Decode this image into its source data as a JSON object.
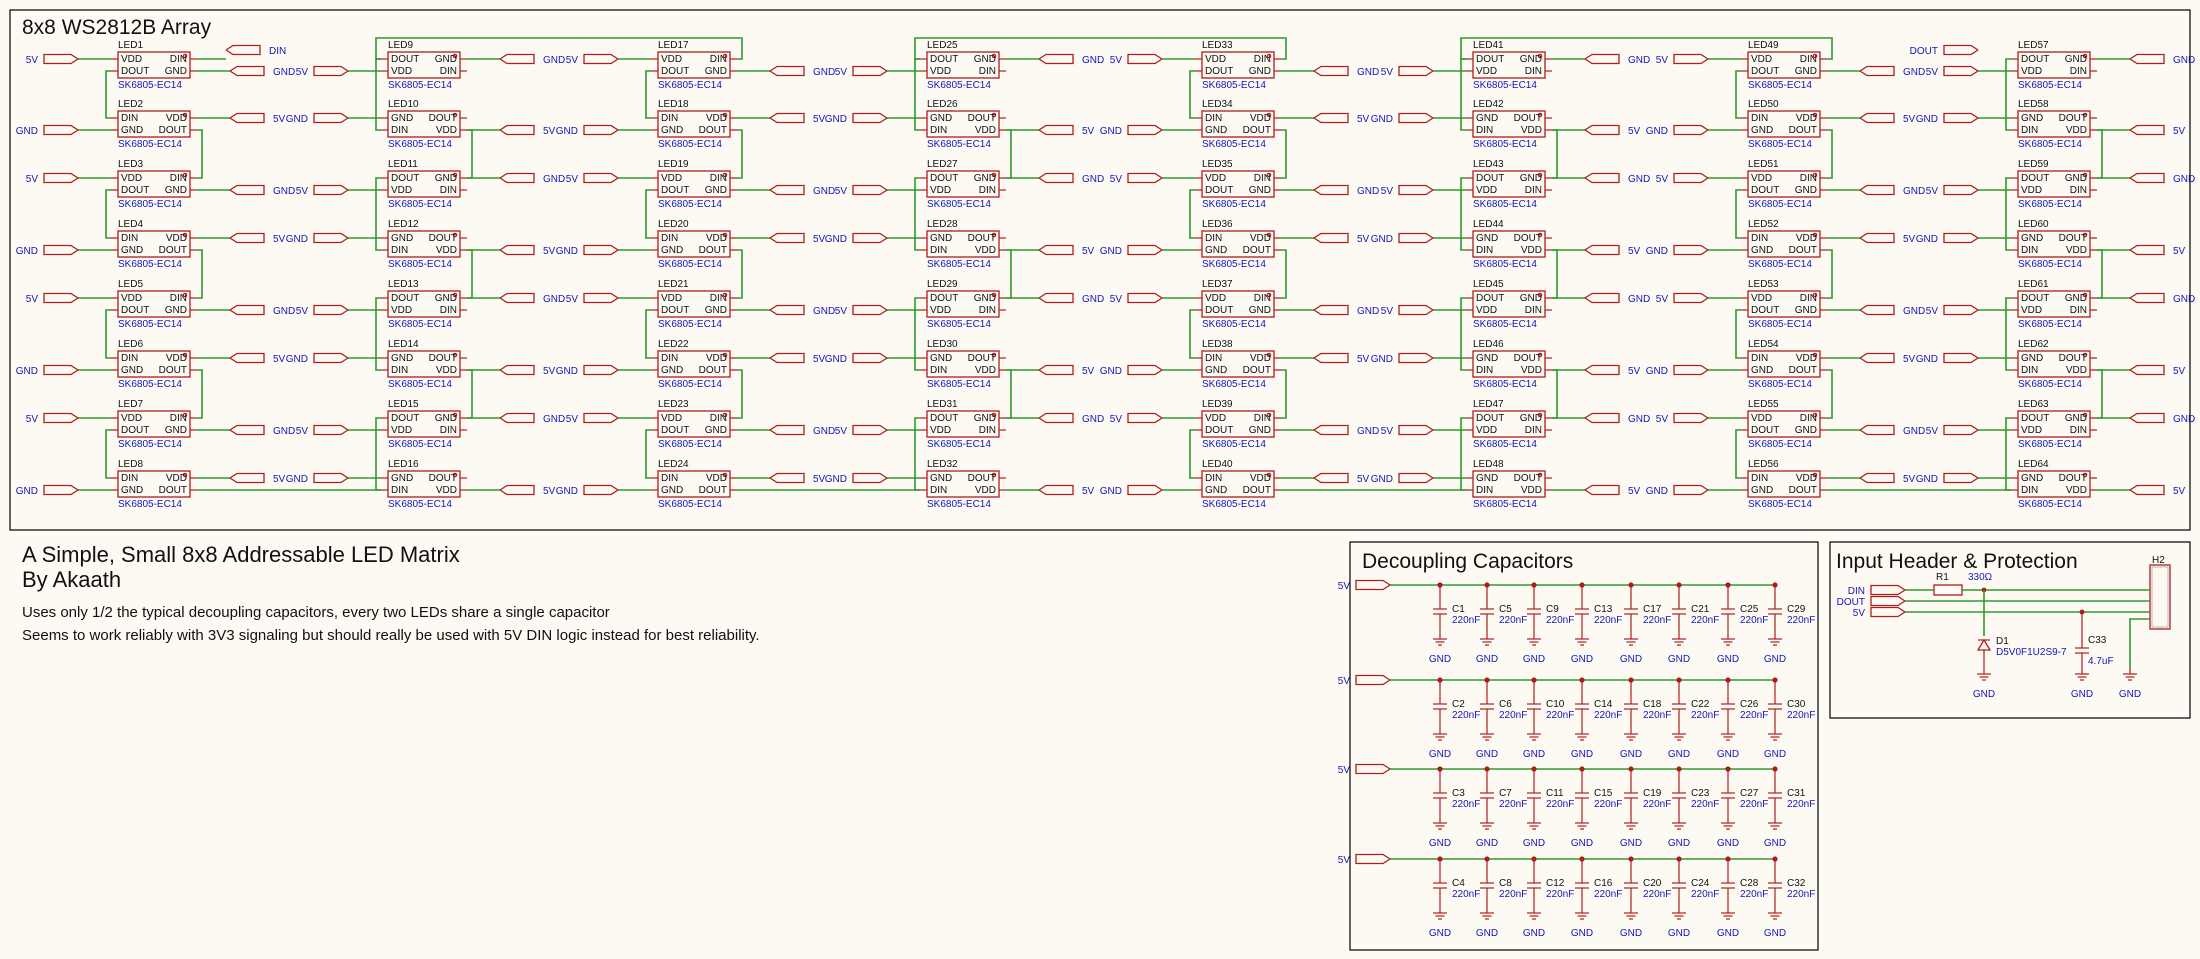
{
  "colors": {
    "wire": "#2e9a2e",
    "part": "#b01c1c",
    "net_label": "#1515b8",
    "text": "#111111",
    "background": "#fdfaf4"
  },
  "array": {
    "title": "8x8 WS2812B Array",
    "part_value": "SK6805-EC14",
    "pin_names": {
      "vdd": "VDD",
      "dout": "DOUT",
      "gnd": "GND",
      "din": "DIN"
    },
    "net_5v": "5V",
    "net_gnd": "GND",
    "net_din": "DIN",
    "net_dout": "DOUT",
    "refs": [
      [
        "LED1",
        "LED2",
        "LED3",
        "LED4",
        "LED5",
        "LED6",
        "LED7",
        "LED8"
      ],
      [
        "LED9",
        "LED10",
        "LED11",
        "LED12",
        "LED13",
        "LED14",
        "LED15",
        "LED16"
      ],
      [
        "LED17",
        "LED18",
        "LED19",
        "LED20",
        "LED21",
        "LED22",
        "LED23",
        "LED24"
      ],
      [
        "LED25",
        "LED26",
        "LED27",
        "LED28",
        "LED29",
        "LED30",
        "LED31",
        "LED32"
      ],
      [
        "LED33",
        "LED34",
        "LED35",
        "LED36",
        "LED37",
        "LED38",
        "LED39",
        "LED40"
      ],
      [
        "LED41",
        "LED42",
        "LED43",
        "LED44",
        "LED45",
        "LED46",
        "LED47",
        "LED48"
      ],
      [
        "LED49",
        "LED50",
        "LED51",
        "LED52",
        "LED53",
        "LED54",
        "LED55",
        "LED56"
      ],
      [
        "LED57",
        "LED58",
        "LED59",
        "LED60",
        "LED61",
        "LED62",
        "LED63",
        "LED64"
      ]
    ]
  },
  "notes": {
    "title_line1": "A Simple, Small 8x8 Addressable LED Matrix",
    "title_line2": "By Akaath",
    "line1": "Uses only 1/2 the typical decoupling capacitors, every two LEDs share a single capacitor",
    "line2": "Seems to work reliably with 3V3 signaling but should really be used with 5V DIN logic instead for best reliability."
  },
  "decoupling": {
    "title": "Decoupling Capacitors",
    "net_5v": "5V",
    "net_gnd": "GND",
    "cap_value": "220nF",
    "rows": [
      [
        "C1",
        "C5",
        "C9",
        "C13",
        "C17",
        "C21",
        "C25",
        "C29"
      ],
      [
        "C2",
        "C6",
        "C10",
        "C14",
        "C18",
        "C22",
        "C26",
        "C30"
      ],
      [
        "C3",
        "C7",
        "C11",
        "C15",
        "C19",
        "C23",
        "C27",
        "C31"
      ],
      [
        "C4",
        "C8",
        "C12",
        "C16",
        "C20",
        "C24",
        "C28",
        "C32"
      ]
    ]
  },
  "input": {
    "title": "Input Header & Protection",
    "net_din": "DIN",
    "net_dout": "DOUT",
    "net_5v": "5V",
    "net_gnd": "GND",
    "r_ref": "R1",
    "r_value": "330Ω",
    "d_ref": "D1",
    "d_value": "D5V0F1U2S9-7",
    "c_ref": "C33",
    "c_value": "4.7uF",
    "header_ref": "H2"
  }
}
